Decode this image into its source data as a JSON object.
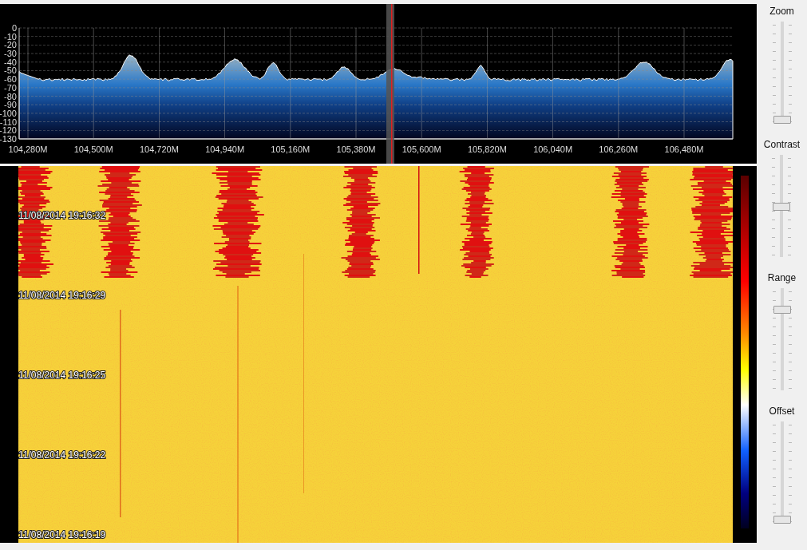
{
  "spectrum": {
    "y_axis_labels": [
      "0",
      "-10",
      "-20",
      "-30",
      "-40",
      "-50",
      "-60",
      "-70",
      "-80",
      "-90",
      "-100",
      "-110",
      "-120",
      "-130"
    ],
    "x_axis_labels": [
      "104,280M",
      "104,500M",
      "104,720M",
      "104,940M",
      "105,160M",
      "105,380M",
      "105,600M",
      "105,820M",
      "106,040M",
      "106,260M",
      "106,480M"
    ]
  },
  "waterfall": {
    "timestamps": [
      "11/08/2014 19:16:32",
      "11/08/2014 19:16:29",
      "11/08/2014 19:16:25",
      "11/08/2014 19:16:22",
      "11/08/2014 19:16:19"
    ]
  },
  "controls": [
    {
      "label": "Zoom",
      "level": 0
    },
    {
      "label": "Contrast",
      "level": 0.5
    },
    {
      "label": "Range",
      "level": 0.83
    },
    {
      "label": "Offset",
      "level": 0
    }
  ]
}
